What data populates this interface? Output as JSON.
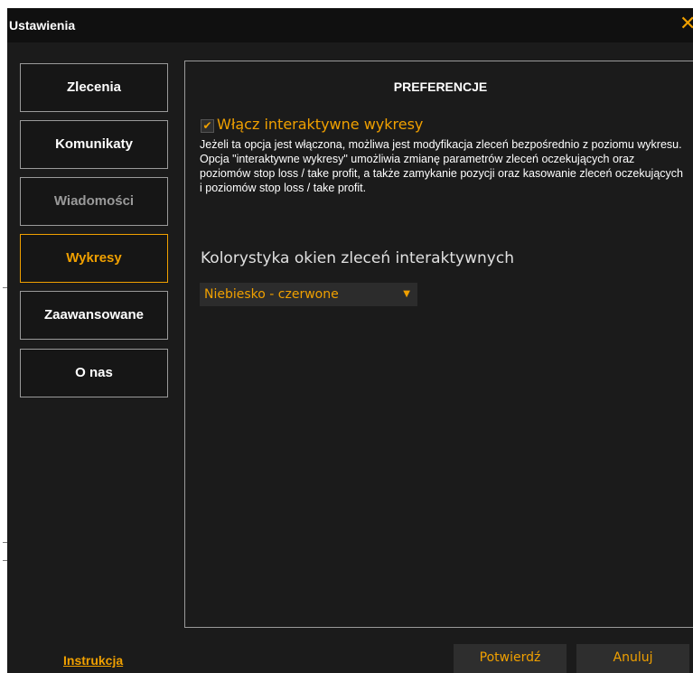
{
  "window": {
    "title": "Ustawienia",
    "close_glyph": "✕"
  },
  "sidebar": {
    "items": [
      {
        "label": "Zlecenia",
        "state": "normal"
      },
      {
        "label": "Komunikaty",
        "state": "normal"
      },
      {
        "label": "Wiadomości",
        "state": "disabled"
      },
      {
        "label": "Wykresy",
        "state": "active"
      },
      {
        "label": "Zaawansowane",
        "state": "normal"
      },
      {
        "label": "O nas",
        "state": "normal"
      }
    ]
  },
  "panel": {
    "heading": "PREFERENCJE",
    "checkbox_label": "Włącz interaktywne wykresy",
    "checkbox_checked": true,
    "checkbox_glyph": "✔",
    "description": "Jeżeli ta opcja jest włączona, możliwa jest modyfikacja zleceń bezpośrednio z poziomu wykresu. Opcja \"interaktywne wykresy\" umożliwia zmianę parametrów zleceń oczekujących oraz poziomów stop loss / take profit, a także zamykanie pozycji oraz kasowanie zleceń oczekujących i poziomów stop loss / take profit.",
    "color_scheme_label": "Kolorystyka okien zleceń interaktywnych",
    "color_scheme_value": "Niebiesko - czerwone",
    "dropdown_glyph": "▼"
  },
  "footer": {
    "help_link": "Instrukcja",
    "confirm": "Potwierdź",
    "cancel": "Anuluj"
  },
  "colors": {
    "accent": "#f0a000",
    "background": "#1b1b1b",
    "titlebar": "#101010",
    "border": "#9a9a9a",
    "text": "#ffffff",
    "disabled_text": "#9a9a9a"
  }
}
